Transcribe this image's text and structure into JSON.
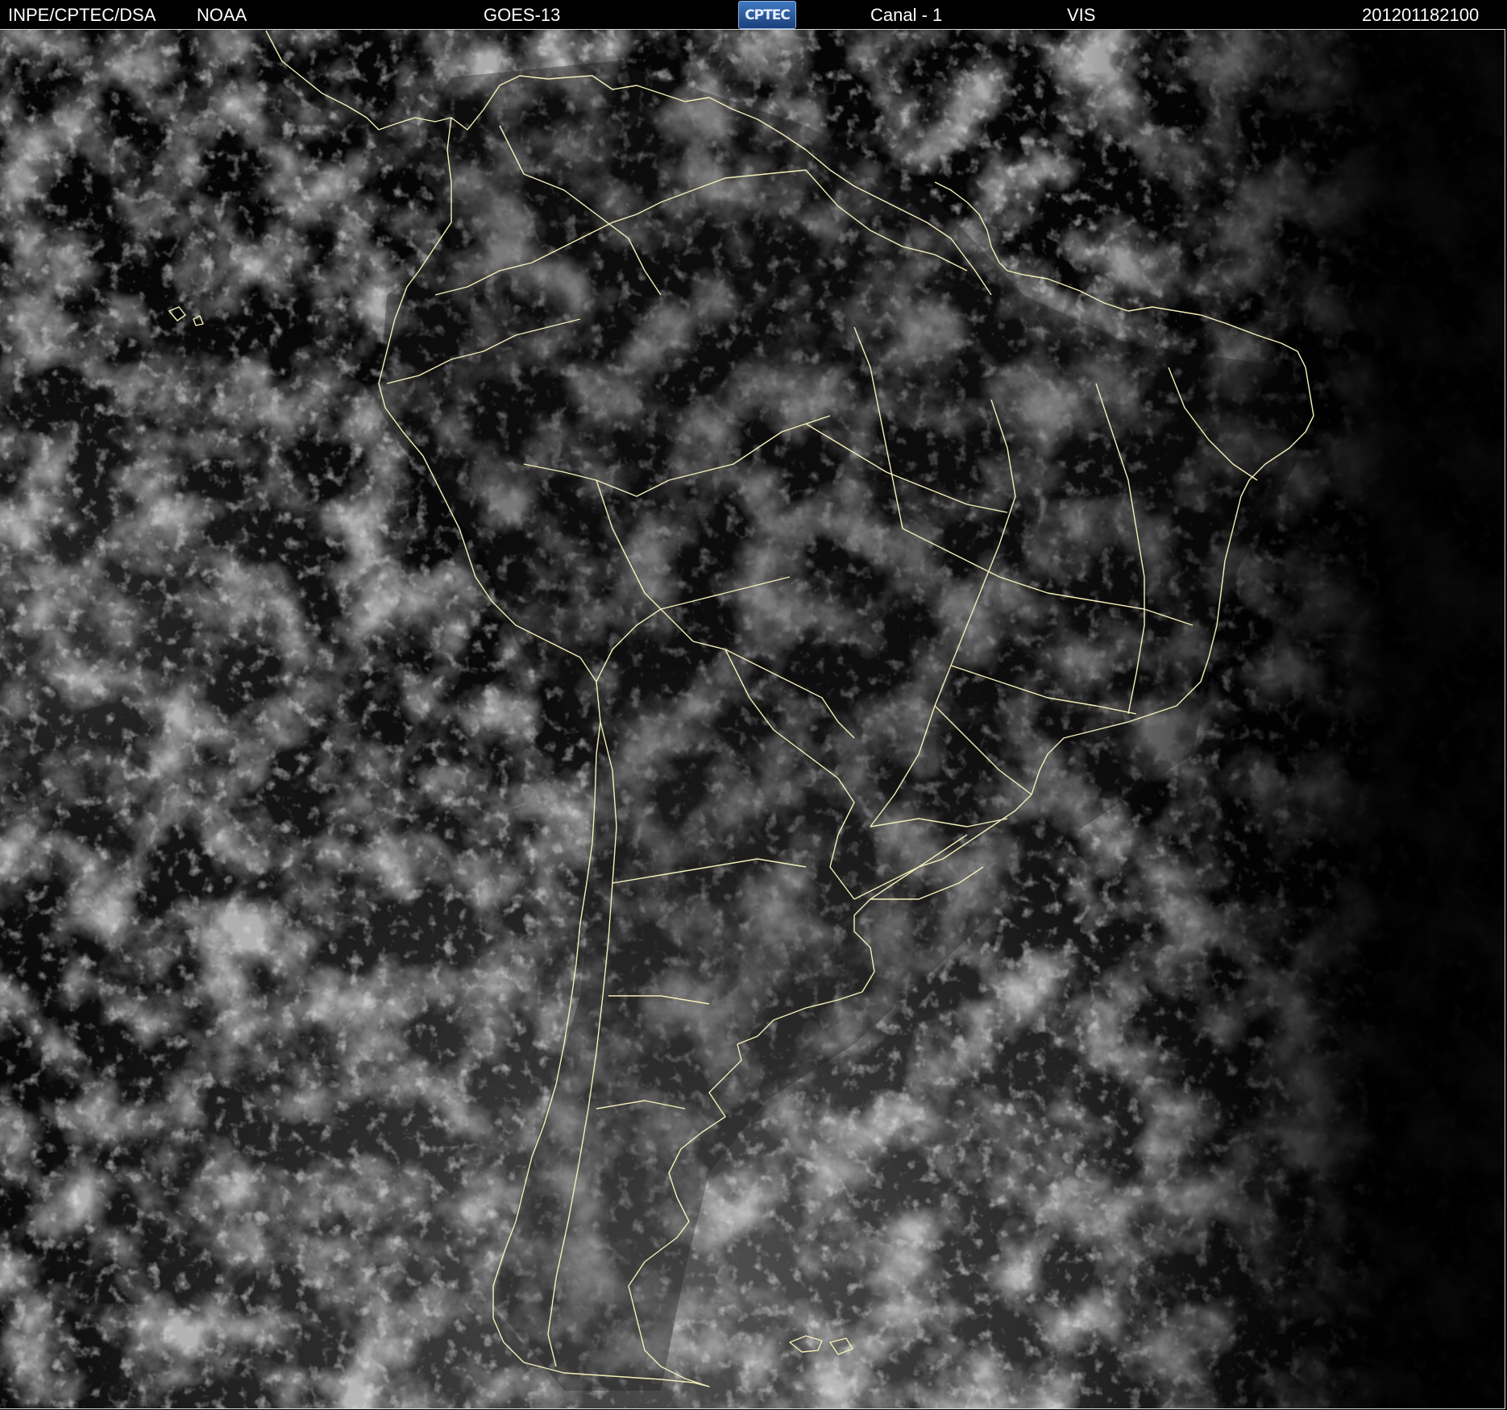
{
  "header": {
    "agency": "INPE/CPTEC/DSA",
    "source": "NOAA",
    "satellite": "GOES-13",
    "logo_text": "CPTEC",
    "channel": "Canal - 1",
    "band": "VIS",
    "timestamp": "201201182100"
  },
  "colors": {
    "background": "#000000",
    "header_text": "#ffffff",
    "border_lines": "#f3f0b8",
    "cloud": "#c8c8c8"
  },
  "map": {
    "type": "visible satellite image",
    "region": "South America"
  }
}
